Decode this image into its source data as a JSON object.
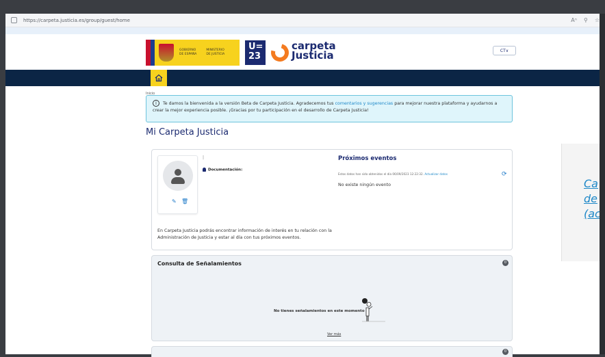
{
  "browser": {
    "url": "https://carpeta.justicia.es/group/guest/home"
  },
  "header": {
    "gov_left": "GOBIERNO\nDE ESPAÑA",
    "gov_right": "MINISTERIO\nDE JUSTICIA",
    "u23_line1": "U=",
    "u23_line2": "23",
    "brand_line1": "carpeta",
    "brand_line2": "Justicia",
    "lang_button": "CT∨"
  },
  "breadcrumb": "Inicio",
  "alert": {
    "text_before": "Te damos la bienvenida a la versión Beta de Carpeta Justicia. Agradecemos tus ",
    "link": "comentarios y sugerencias",
    "text_after": " para mejorar nuestra plataforma y ayudarnos a crear la mejor experiencia posible. ¡Gracias por tu participación en el desarrollo de Carpeta Justicia!"
  },
  "page_title": "Mi Carpeta Justicia",
  "profile": {
    "separator": "|",
    "documentacion": "Documentación:",
    "intro": "En Carpeta Justicia podrás encontrar información de interés en tu relación con la Administración de Justicia y estar al día con tus próximos eventos."
  },
  "events": {
    "title": "Próximos eventos",
    "note": "Estos datos han sido obtenidos el día 06/09/2023 12:22:32.",
    "update_link": "Actualizar datos",
    "empty": "No existe ningún evento"
  },
  "senalamientos": {
    "title": "Consulta de Señalamientos",
    "count": "0",
    "empty": "No tienes señalamientos en este momento",
    "more": "Ver más"
  },
  "next_card": {
    "count": "0"
  },
  "side_panel": {
    "lines": [
      "Ca",
      "de",
      "(ac"
    ]
  }
}
